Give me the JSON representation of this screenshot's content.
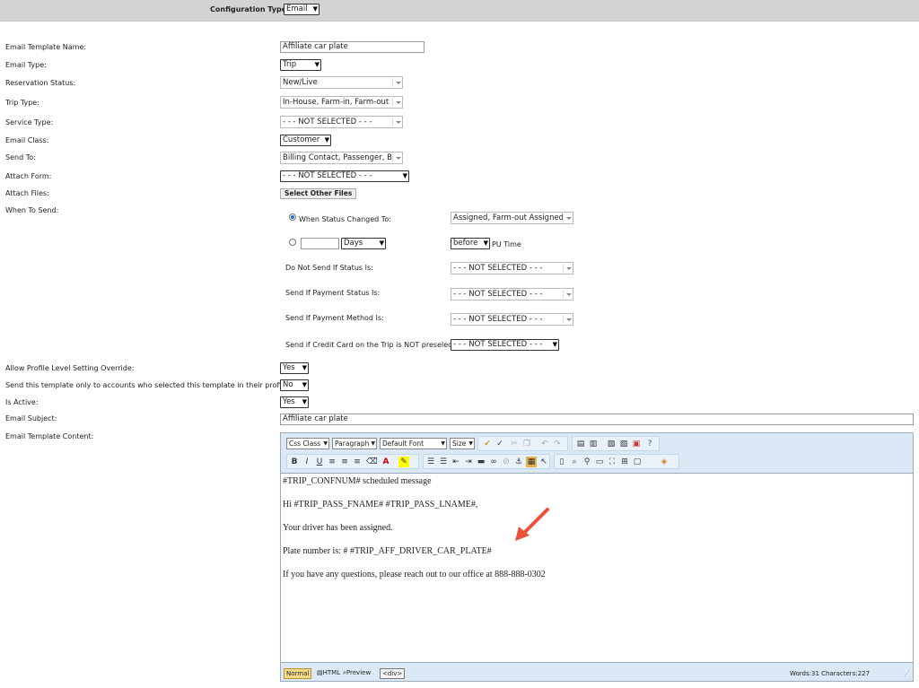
{
  "config": {
    "label": "Configuration Type:",
    "value": "Email"
  },
  "fields": {
    "template_name": {
      "label": "Email Template Name:",
      "value": "Affiliate car plate"
    },
    "email_type": {
      "label": "Email Type:",
      "value": "Trip"
    },
    "reservation_status": {
      "label": "Reservation Status:",
      "value": "New/Live"
    },
    "trip_type": {
      "label": "Trip Type:",
      "value": "In-House, Farm-in, Farm-out"
    },
    "service_type": {
      "label": "Service Type:",
      "value": "- - - NOT SELECTED - - -"
    },
    "email_class": {
      "label": "Email Class:",
      "value": "Customer"
    },
    "send_to": {
      "label": "Send To:",
      "value": "Billing Contact, Passenger, B"
    },
    "attach_form": {
      "label": "Attach Form:",
      "value": "- - - NOT SELECTED - - -"
    },
    "attach_files": {
      "label": "Attach Files:",
      "button": "Select Other Files"
    },
    "when_to_send": {
      "label": "When To Send:"
    },
    "allow_override": {
      "label": "Allow Profile Level Setting Override:",
      "value": "Yes"
    },
    "only_selected": {
      "label": "Send this template only to accounts who selected this template in their profiles:",
      "value": "No"
    },
    "is_active": {
      "label": "Is Active:",
      "value": "Yes"
    },
    "subject": {
      "label": "Email Subject:",
      "value": "Affiliate car plate"
    },
    "content": {
      "label": "Email Template Content:"
    }
  },
  "when": {
    "status_changed_label": "When Status Changed To:",
    "status_changed_value": "Assigned, Farm-out Assigned",
    "days_value": "",
    "days_unit": "Days",
    "before_value": "before",
    "pu_time": "PU Time",
    "do_not_send_label": "Do Not Send If Status Is:",
    "do_not_send_value": "- - - NOT SELECTED - - -",
    "payment_status_label": "Send If Payment Status Is:",
    "payment_status_value": "- - - NOT SELECTED - - -",
    "payment_method_label": "Send If Payment Method Is:",
    "payment_method_value": "- - - NOT SELECTED - - -",
    "credit_card_label": "Send if Credit Card on the Trip is NOT preselected:",
    "credit_card_value": "- - - NOT SELECTED - - -"
  },
  "editor": {
    "css_class": "Css Class",
    "paragraph": "Paragraph",
    "font": "Default Font",
    "size": "Size",
    "lines": [
      "#TRIP_CONFNUM#  scheduled message",
      "Hi  #TRIP_PASS_FNAME# #TRIP_PASS_LNAME#,",
      "Your driver has been assigned.",
      "Plate number is: # #TRIP_AFF_DRIVER_CAR_PLATE#",
      "If you have any questions, please reach out to our office at 888-888-0302"
    ],
    "modes": {
      "normal": "Normal",
      "html": "HTML",
      "preview": "Preview",
      "tag": "<div>"
    },
    "stats": "Words:31 Characters:227"
  },
  "colors": {
    "arrow": "#e8533a"
  }
}
